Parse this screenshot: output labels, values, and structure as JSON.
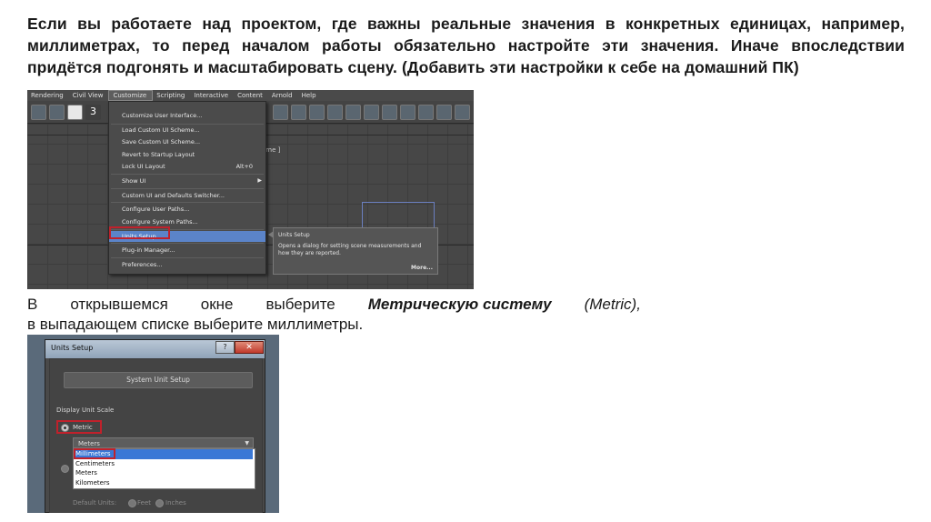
{
  "text": {
    "para1": "Если вы работаете над проектом, где важны реальные значения в конкретных единицах, например, миллиметрах, то перед началом работы обязательно настройте эти значения. Иначе впоследствии придётся подгонять и масштабировать сцену. (Добавить эти настройки к себе на домашний ПК)",
    "para2_pre": "В открывшемся окне выберите",
    "para2_bold_italic": "Метрическую систему",
    "para2_italic": "(Metric),",
    "para2_line2": "в выпадающем списке выберите миллиметры."
  },
  "shot1": {
    "menubar": [
      "Rendering",
      "Civil View",
      "Customize",
      "Scripting",
      "Interactive",
      "Content",
      "Arnold",
      "Help"
    ],
    "active_menu": "Customize",
    "viewport_title": "ame ]",
    "menu_items": [
      {
        "label": "Customize User Interface...",
        "shortcut": "",
        "submenu": false
      },
      {
        "label": "Load Custom UI Scheme...",
        "shortcut": "",
        "submenu": false
      },
      {
        "label": "Save Custom UI Scheme...",
        "shortcut": "",
        "submenu": false
      },
      {
        "label": "Revert to Startup Layout",
        "shortcut": "",
        "submenu": false
      },
      {
        "label": "Lock UI Layout",
        "shortcut": "Alt+0",
        "submenu": false
      },
      {
        "label": "Show UI",
        "shortcut": "",
        "submenu": true
      },
      {
        "label": "Custom UI and Defaults Switcher...",
        "shortcut": "",
        "submenu": false
      },
      {
        "label": "Configure User Paths...",
        "shortcut": "",
        "submenu": false
      },
      {
        "label": "Configure System Paths...",
        "shortcut": "",
        "submenu": false
      },
      {
        "label": "Units Setup...",
        "shortcut": "",
        "submenu": false,
        "highlighted": true
      },
      {
        "label": "Plug-in Manager...",
        "shortcut": "",
        "submenu": false
      },
      {
        "label": "Preferences...",
        "shortcut": "",
        "submenu": false
      }
    ],
    "tooltip": {
      "title": "Units Setup",
      "description": "Opens a dialog for setting scene measurements and how they are reported.",
      "more": "More..."
    }
  },
  "shot2": {
    "dialog_title": "Units Setup",
    "help_glyph": "?",
    "close_glyph": "✕",
    "system_unit_button": "System Unit Setup",
    "group_label": "Display Unit Scale",
    "metric_label": "Metric",
    "select_value": "Meters",
    "options": [
      "Millimeters",
      "Centimeters",
      "Meters",
      "Kilometers"
    ],
    "selected_option": "Millimeters",
    "default_units_label": "Default Units:",
    "feet_label": "Feet",
    "inches_label": "Inches"
  }
}
